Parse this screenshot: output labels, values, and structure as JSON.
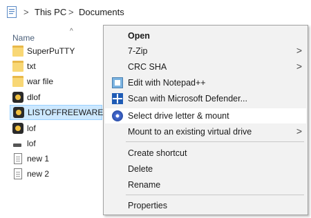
{
  "address_bar": {
    "crumbs": [
      "This PC",
      "Documents"
    ],
    "separator": ">"
  },
  "file_list": {
    "column_header": "Name",
    "sort_indicator": "^",
    "items": [
      {
        "name": "SuperPuTTY",
        "icon": "folder-icon"
      },
      {
        "name": "txt",
        "icon": "folder-icon"
      },
      {
        "name": "war file",
        "icon": "folder-icon"
      },
      {
        "name": "dlof",
        "icon": "app-icon"
      },
      {
        "name": "LISTOFFREEWARE",
        "icon": "app-icon",
        "selected": true
      },
      {
        "name": "lof",
        "icon": "app-icon"
      },
      {
        "name": "lof",
        "icon": "drive-icon"
      },
      {
        "name": "new 1",
        "icon": "text-file-icon"
      },
      {
        "name": "new 2",
        "icon": "text-file-icon"
      }
    ]
  },
  "context_menu": {
    "items": [
      {
        "label": "Open",
        "bold": true,
        "submenu": false
      },
      {
        "label": "7-Zip",
        "submenu": true
      },
      {
        "label": "CRC SHA",
        "submenu": true
      },
      {
        "label": "Edit with Notepad++",
        "icon": "notepad-plus-plus-icon",
        "submenu": false
      },
      {
        "label": "Scan with Microsoft Defender...",
        "icon": "defender-shield-icon",
        "submenu": false
      },
      {
        "label": "Select drive letter & mount",
        "icon": "mount-drive-icon",
        "submenu": false,
        "hovered": true
      },
      {
        "label": "Mount to an existing virtual drive",
        "submenu": true
      },
      {
        "label": "Create shortcut",
        "submenu": false
      },
      {
        "label": "Delete",
        "submenu": false
      },
      {
        "label": "Rename",
        "submenu": false
      },
      {
        "label": "Properties",
        "submenu": false
      }
    ],
    "submenu_arrow": ">"
  },
  "colors": {
    "selection_bg": "#cce8ff",
    "selection_border": "#99d1ff",
    "menu_bg": "#f2f2f2",
    "menu_hover_bg": "#ffffff",
    "folder": "#f8d775"
  }
}
